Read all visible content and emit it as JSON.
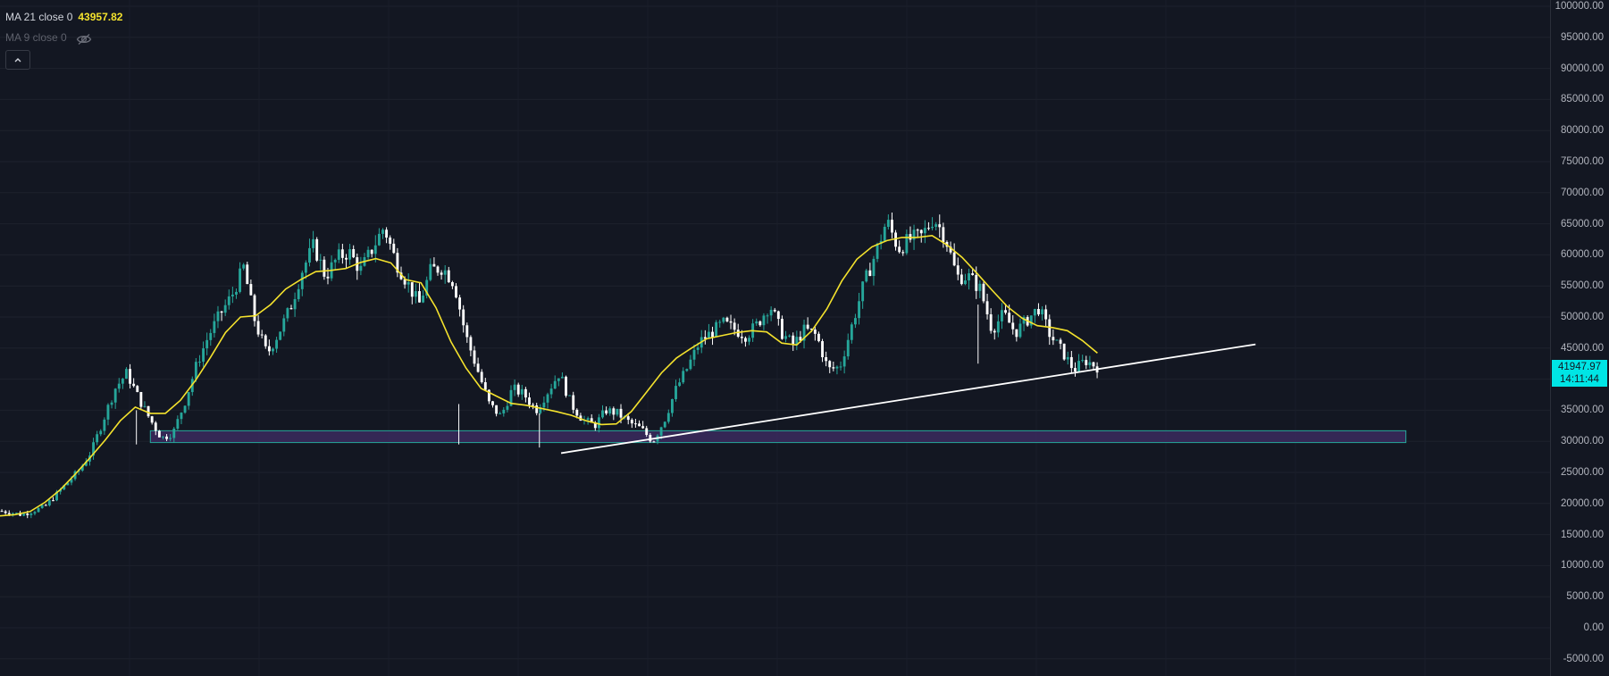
{
  "legend": {
    "ma21": {
      "label": "MA 21 close 0",
      "value": "43957.82",
      "color": "#f4e22d"
    },
    "ma9": {
      "label": "MA 9 close 0"
    },
    "collapse_icon": "chevron-up-icon",
    "hidden_icon": "eye-off-icon"
  },
  "current_price": {
    "price": "41947.97",
    "countdown": "14:11:44",
    "color": "#00e5e5"
  },
  "chart_data": {
    "type": "candlestick",
    "title": "",
    "y_ticks": [
      "100000.00",
      "95000.00",
      "90000.00",
      "85000.00",
      "80000.00",
      "75000.00",
      "70000.00",
      "65000.00",
      "60000.00",
      "55000.00",
      "50000.00",
      "45000.00",
      "40000.00",
      "35000.00",
      "30000.00",
      "25000.00",
      "20000.00",
      "15000.00",
      "10000.00",
      "5000.00",
      "0.00",
      "-5000.00"
    ],
    "ylim": [
      -7000,
      101500
    ],
    "grid": true,
    "colors": {
      "up": "#26a69a",
      "down": "#ffffff",
      "ma21": "#f4e22d",
      "trendline": "#ffffff",
      "zone_fill": "#3b2a5e",
      "zone_border": "#26a69a"
    },
    "price_path": [
      18800,
      18600,
      18200,
      18800,
      19500,
      21500,
      23500,
      25500,
      28500,
      33500,
      38500,
      41000,
      37000,
      33500,
      30500,
      31500,
      36500,
      42500,
      47000,
      50500,
      53500,
      58000,
      49000,
      44000,
      47500,
      51500,
      57500,
      61500,
      56500,
      59500,
      60500,
      57500,
      61000,
      64500,
      59000,
      55500,
      52000,
      57500,
      58000,
      55500,
      47000,
      41500,
      36000,
      34000,
      38500,
      37500,
      35000,
      38000,
      41000,
      36000,
      33500,
      32500,
      35000,
      34500,
      33000,
      32000,
      30000,
      33500,
      38500,
      42000,
      46000,
      47500,
      49000,
      48000,
      47000,
      49000,
      52000,
      47500,
      45500,
      48000,
      47000,
      41500,
      42000,
      48500,
      55000,
      60000,
      65500,
      61000,
      62500,
      63000,
      66000,
      63000,
      56500,
      56500,
      54500,
      48000,
      50500,
      47500,
      49500,
      51500,
      47000,
      44500,
      41500,
      43000,
      42000
    ],
    "ma21_path": [
      18000,
      18200,
      18700,
      20200,
      22200,
      24700,
      27400,
      30200,
      33300,
      35500,
      34500,
      34500,
      36600,
      39800,
      43500,
      47500,
      50000,
      50200,
      52000,
      54500,
      56000,
      57300,
      57500,
      57800,
      58800,
      59400,
      58700,
      56000,
      55500,
      51500,
      46000,
      41800,
      38500,
      37300,
      36100,
      35800,
      35300,
      34800,
      34200,
      33300,
      32700,
      32800,
      34800,
      37900,
      41000,
      43400,
      45000,
      46500,
      47000,
      47500,
      47800,
      47600,
      45800,
      45500,
      47800,
      51300,
      55800,
      59300,
      61300,
      62300,
      62800,
      62800,
      63100,
      61600,
      59600,
      57000,
      54300,
      51700,
      49800,
      48600,
      48300,
      47800,
      46200,
      44200
    ],
    "trendline": {
      "start": [
        0.362,
        28100
      ],
      "end": [
        0.81,
        45600
      ]
    },
    "support_zone": {
      "from": 29800,
      "to": 31700,
      "start": 0.097,
      "end": 0.907
    }
  }
}
